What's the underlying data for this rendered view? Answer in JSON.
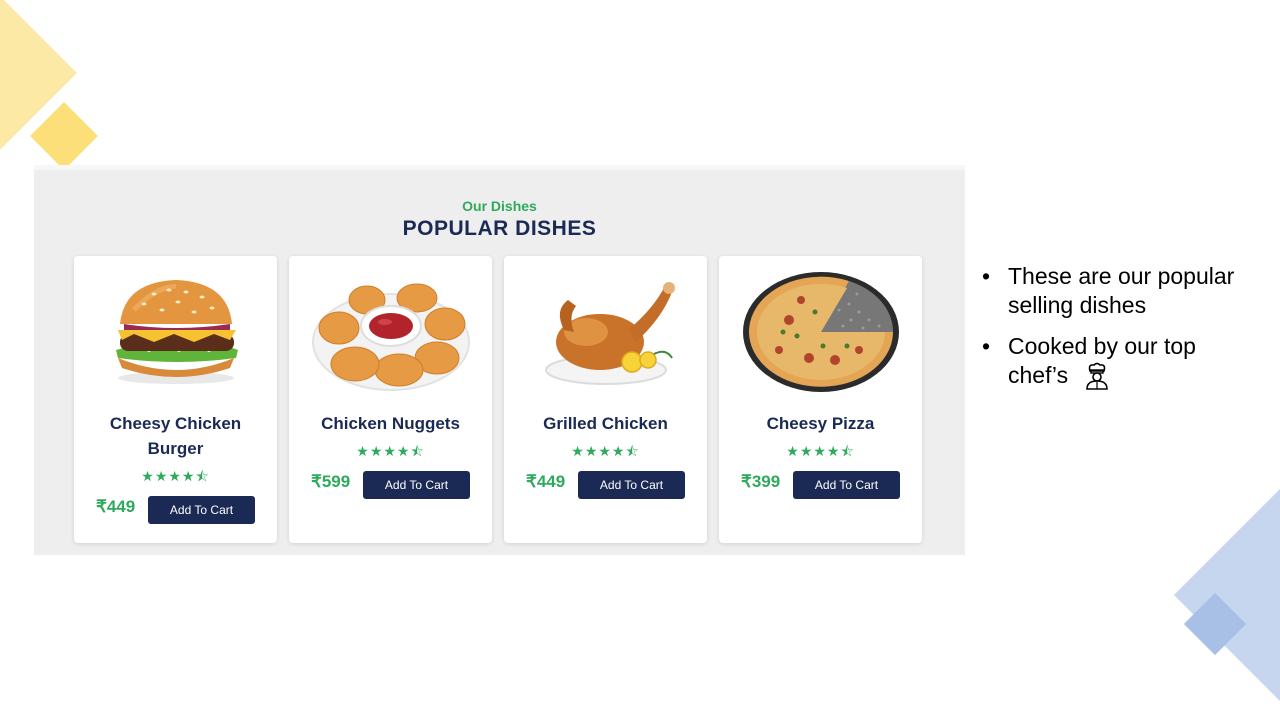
{
  "section": {
    "subtitle": "Our Dishes",
    "title": "POPULAR DISHES"
  },
  "dishes": [
    {
      "name": "Cheesy Chicken Burger",
      "price": "₹449",
      "button_label": "Add To Cart",
      "rating": 4.5,
      "stars": "★★★★⯪",
      "image_icon": "burger-image"
    },
    {
      "name": "Chicken Nuggets",
      "price": "₹599",
      "button_label": "Add To Cart",
      "rating": 4.5,
      "stars": "★★★★⯪",
      "image_icon": "nuggets-image"
    },
    {
      "name": "Grilled Chicken",
      "price": "₹449",
      "button_label": "Add To Cart",
      "rating": 4.5,
      "stars": "★★★★⯪",
      "image_icon": "grilled-chicken-image"
    },
    {
      "name": "Cheesy Pizza",
      "price": "₹399",
      "button_label": "Add To Cart",
      "rating": 4.5,
      "stars": "★★★★⯪",
      "image_icon": "pizza-image"
    }
  ],
  "bullets": [
    {
      "text": "These are our popular selling dishes"
    },
    {
      "text": "Cooked by our top chef’s",
      "icon": "chef-icon"
    }
  ],
  "colors": {
    "accent_green": "#2eaa5c",
    "navy": "#1b2a55",
    "panel_bg": "#eeeeee",
    "deco_yellow": "#fde9a6",
    "deco_blue": "#c7d6ef"
  }
}
